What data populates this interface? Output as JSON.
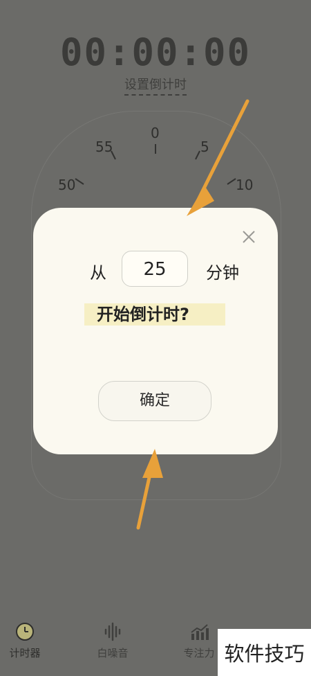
{
  "timer": {
    "display": "00:00:00",
    "set_countdown_label": "设置倒计时",
    "dial_numbers": [
      "0",
      "5",
      "10",
      "50",
      "55"
    ]
  },
  "dialog": {
    "from_label": "从",
    "minutes_value": "25",
    "minutes_unit": "分钟",
    "question": "开始倒计时?",
    "confirm_label": "确定"
  },
  "nav": {
    "items": [
      {
        "label": "计时器",
        "icon": "clock-icon",
        "active": true
      },
      {
        "label": "白噪音",
        "icon": "sound-wave-icon",
        "active": false
      },
      {
        "label": "专注力",
        "icon": "chart-icon",
        "active": false
      }
    ]
  },
  "watermark": "软件技巧",
  "colors": {
    "overlay": "#6b6b68",
    "dialog_bg": "#fbf9f0",
    "highlight": "#f6efc4",
    "arrow": "#e8a13a"
  }
}
